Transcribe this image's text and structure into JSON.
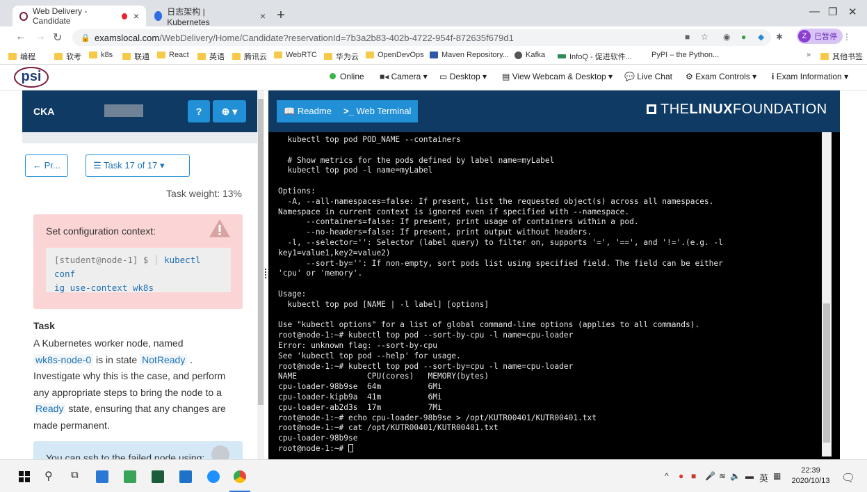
{
  "browser": {
    "tabs": [
      {
        "title": "Web Delivery - Candidate",
        "active": true
      },
      {
        "title": "日志架构 | Kubernetes",
        "active": false
      }
    ],
    "url_host": "examslocal.com",
    "url_path": "/WebDelivery/Home/Candidate?reservationId=7b3a2b83-402b-4722-954f-872635f679d1",
    "profile_initial": "Z",
    "profile_label": "已暂停",
    "bookmarks": [
      "编程",
      "软考",
      "k8s",
      "联通",
      "React",
      "英语",
      "腾讯云",
      "WebRTC",
      "华为云",
      "OpenDevOps",
      "Maven Repository...",
      "Kafka",
      "InfoQ - 促进软件...",
      "PyPI – the Python...",
      "其他书签"
    ],
    "bookmarks_more": "»"
  },
  "psi": {
    "logo": "psi",
    "status": "Online",
    "camera": "Camera",
    "desktop": "Desktop",
    "view_webcam": "View Webcam & Desktop",
    "live_chat": "Live Chat",
    "exam_controls": "Exam Controls",
    "exam_info": "Exam Information"
  },
  "left": {
    "exam_code": "CKA",
    "help_glyph": "?",
    "prev_button": "← Pr...",
    "task_menu": "☰ Task 17 of 17 ▾",
    "task_weight": "Task weight: 13%",
    "context_title": "Set configuration context:",
    "prompt": "[student@node-1] $",
    "command_line1": "kubectl conf",
    "command_line2": "ig use-context wk8s",
    "task_heading": "Task",
    "task_line1": "A Kubernetes worker node, named",
    "node_name": "wk8s-node-0",
    "is_in_state": " is in state ",
    "state_notready": "NotReady",
    "dot": " .",
    "task_line3": "Investigate why this is the case, and perform",
    "task_line4": "any appropriate steps to bring the node to a",
    "state_ready": "Ready",
    "task_line5_rest": " state, ensuring that any changes are",
    "task_line6": "made permanent.",
    "info_text": "You can  ssh  to the failed node using:"
  },
  "right": {
    "readme_tab": "Readme",
    "terminal_tab": "Web Terminal",
    "logo_the": "THE",
    "logo_linux": "LINUX",
    "logo_foundation": "FOUNDATION",
    "terminal_lines": [
      "  kubectl top pod POD_NAME --containers",
      "",
      "  # Show metrics for the pods defined by label name=myLabel",
      "  kubectl top pod -l name=myLabel",
      "",
      "Options:",
      "  -A, --all-namespaces=false: If present, list the requested object(s) across all namespaces.",
      "Namespace in current context is ignored even if specified with --namespace.",
      "      --containers=false: If present, print usage of containers within a pod.",
      "      --no-headers=false: If present, print output without headers.",
      "  -l, --selector='': Selector (label query) to filter on, supports '=', '==', and '!='.(e.g. -l",
      "key1=value1,key2=value2)",
      "      --sort-by='': If non-empty, sort pods list using specified field. The field can be either",
      "'cpu' or 'memory'.",
      "",
      "Usage:",
      "  kubectl top pod [NAME | -l label] [options]",
      "",
      "Use \"kubectl options\" for a list of global command-line options (applies to all commands).",
      "root@node-1:~# kubectl top pod --sort-by-cpu -l name=cpu-loader",
      "Error: unknown flag: --sort-by-cpu",
      "See 'kubectl top pod --help' for usage.",
      "root@node-1:~# kubectl top pod --sort-by=cpu -l name=cpu-loader",
      "NAME               CPU(cores)   MEMORY(bytes)",
      "cpu-loader-98b9se  64m          6Mi",
      "cpu-loader-kipb9a  41m          6Mi",
      "cpu-loader-ab2d3s  17m          7Mi",
      "root@node-1:~# echo cpu-loader-98b9se > /opt/KUTR00401/KUTR00401.txt",
      "root@node-1:~# cat /opt/KUTR00401/KUTR00401.txt",
      "cpu-loader-98b9se"
    ],
    "prompt_last": "root@node-1:~# "
  },
  "taskbar": {
    "ime": "英",
    "time": "22:39",
    "date": "2020/10/13"
  }
}
